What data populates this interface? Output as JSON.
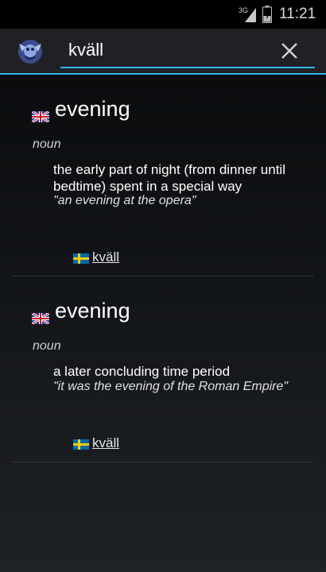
{
  "status_bar": {
    "network": "3G",
    "time": "11:21"
  },
  "search": {
    "query": "kväll",
    "icon": "app-logo-icon",
    "clear_icon": "close-icon",
    "accent_color": "#33b5e5"
  },
  "entries": [
    {
      "flag": "uk-flag-icon",
      "headword": "evening",
      "pos": "noun",
      "definition": "the early part of night (from dinner until bedtime) spent in a special way",
      "example": "\"an evening at the opera\"",
      "translation_flag": "sweden-flag-icon",
      "translation": "kväll"
    },
    {
      "flag": "uk-flag-icon",
      "headword": "evening",
      "pos": "noun",
      "definition": "a later concluding time period",
      "example": "\"it was the evening of the Roman Empire\"",
      "translation_flag": "sweden-flag-icon",
      "translation": "kväll"
    }
  ]
}
